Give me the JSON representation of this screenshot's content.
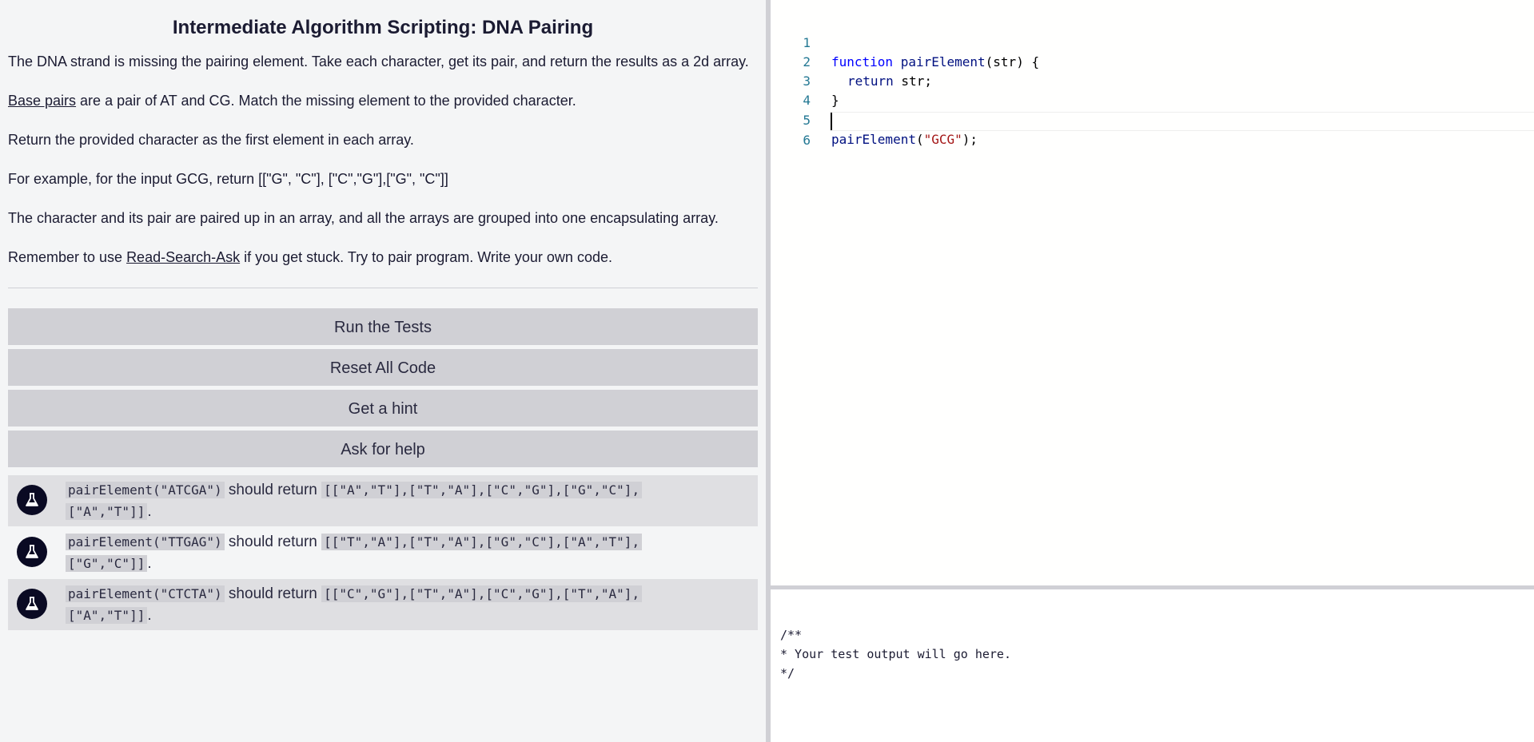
{
  "challenge": {
    "title": "Intermediate Algorithm Scripting: DNA Pairing",
    "p1": "The DNA strand is missing the pairing element. Take each character, get its pair, and return the results as a 2d array.",
    "p2_link": "Base pairs",
    "p2_rest": " are a pair of AT and CG. Match the missing element to the provided character.",
    "p3": "Return the provided character as the first element in each array.",
    "p4": "For example, for the input GCG, return [[\"G\", \"C\"], [\"C\",\"G\"],[\"G\", \"C\"]]",
    "p5": "The character and its pair are paired up in an array, and all the arrays are grouped into one encapsulating array.",
    "p6_pre": "Remember to use ",
    "p6_link": "Read-Search-Ask",
    "p6_post": " if you get stuck. Try to pair program. Write your own code."
  },
  "buttons": {
    "run": "Run the Tests",
    "reset": "Reset All Code",
    "hint": "Get a hint",
    "help": "Ask for help"
  },
  "tests": [
    {
      "call": "pairElement(\"ATCGA\")",
      "mid": " should return ",
      "expected": "[[\"A\",\"T\"],[\"T\",\"A\"],[\"C\",\"G\"],[\"G\",\"C\"],",
      "expected2": "[\"A\",\"T\"]]",
      "end": "."
    },
    {
      "call": "pairElement(\"TTGAG\")",
      "mid": " should return ",
      "expected": "[[\"T\",\"A\"],[\"T\",\"A\"],[\"G\",\"C\"],[\"A\",\"T\"],",
      "expected2": "[\"G\",\"C\"]]",
      "end": "."
    },
    {
      "call": "pairElement(\"CTCTA\")",
      "mid": " should return ",
      "expected": "[[\"C\",\"G\"],[\"T\",\"A\"],[\"C\",\"G\"],[\"T\",\"A\"],",
      "expected2": "[\"A\",\"T\"]]",
      "end": "."
    }
  ],
  "editor": {
    "line_numbers": [
      "1",
      "2",
      "3",
      "4",
      "5",
      "6"
    ],
    "l1_kw": "function",
    "l1_fn": " pairElement",
    "l1_rest": "(str) {",
    "l2_kw": "return",
    "l2_rest": " str;",
    "l3": "}",
    "l5_fn": "pairElement",
    "l5_open": "(",
    "l5_str": "\"GCG\"",
    "l5_close": ");"
  },
  "output": {
    "text": "/**\n* Your test output will go here.\n*/"
  }
}
